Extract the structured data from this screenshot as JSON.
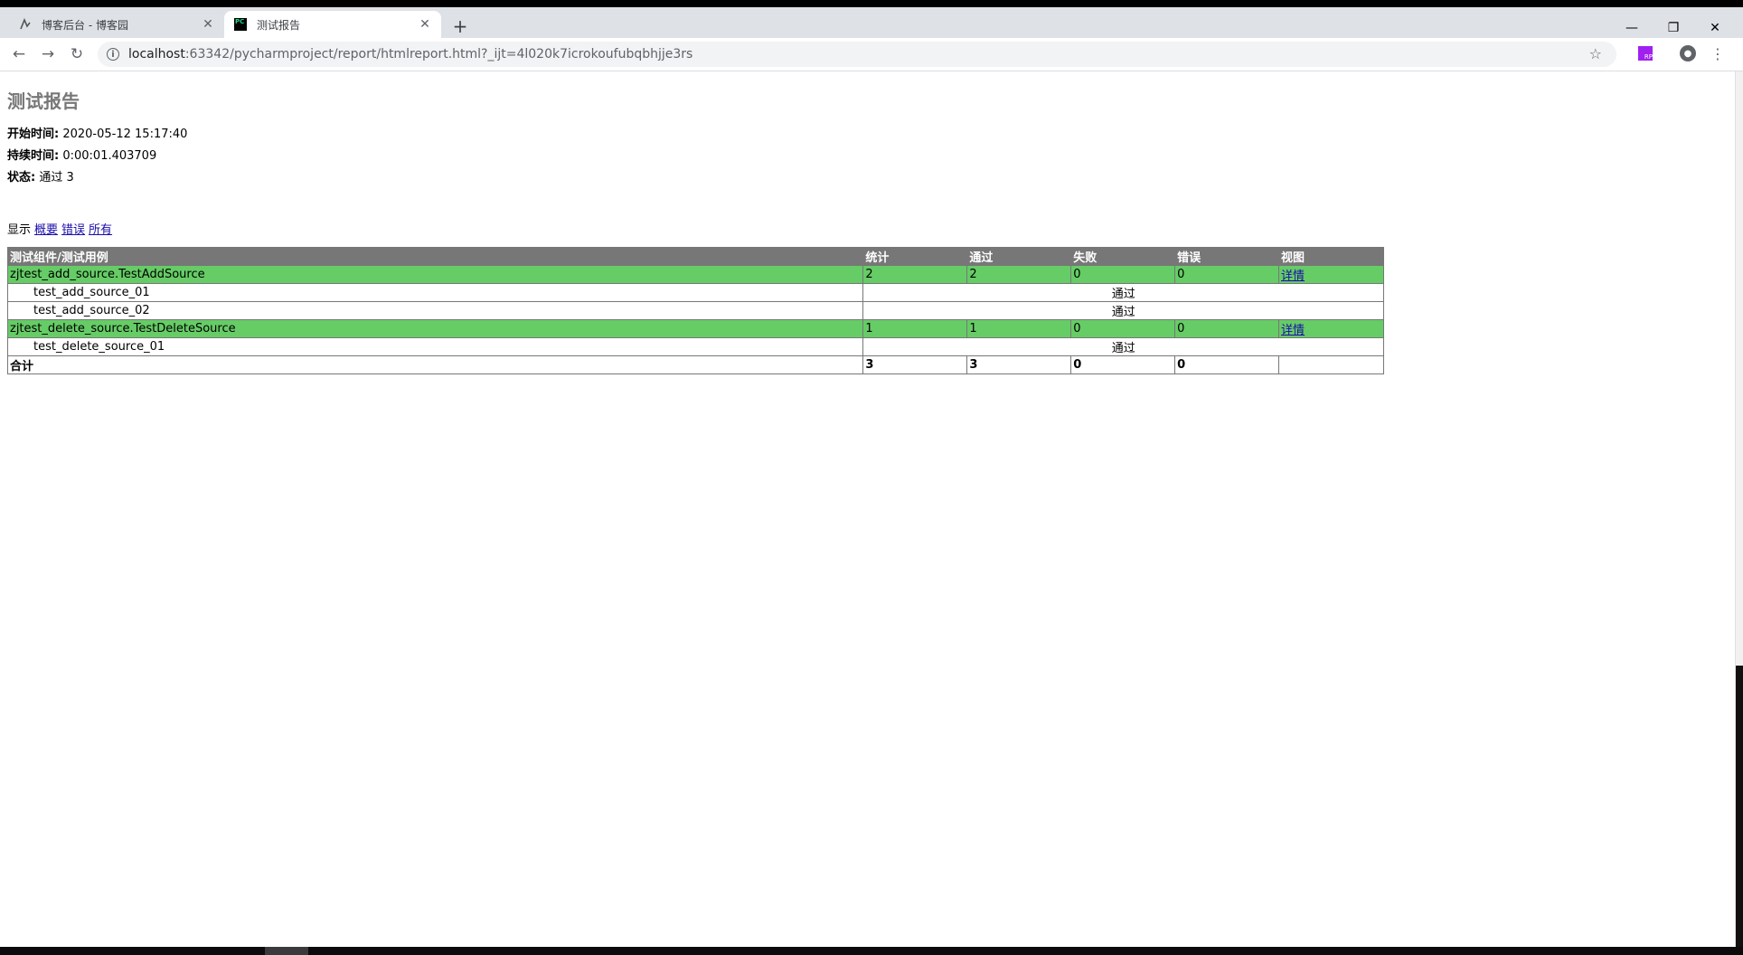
{
  "browser": {
    "tabs": [
      {
        "title": "博客后台 - 博客园",
        "active": false,
        "icon": "cnblogs-icon"
      },
      {
        "title": "测试报告",
        "active": true,
        "icon": "pycharm-icon",
        "icon_text": "PC"
      }
    ],
    "url_host": "localhost",
    "url_rest": ":63342/pycharmproject/report/htmlreport.html?_ijt=4l020k7icrokoufubqbhjje3rs",
    "ext_label": "RP"
  },
  "report": {
    "title": "测试报告",
    "start_label": "开始时间:",
    "start_value": "2020-05-12 15:17:40",
    "duration_label": "持续时间:",
    "duration_value": "0:00:01.403709",
    "status_label": "状态:",
    "status_value": "通过 3",
    "filter_label": "显示",
    "filter_links": [
      "概要",
      "错误",
      "所有"
    ]
  },
  "table": {
    "headers": [
      "测试组件/测试用例",
      "统计",
      "通过",
      "失败",
      "错误",
      "视图"
    ],
    "suites": [
      {
        "name": "zjtest_add_source.TestAddSource",
        "count": "2",
        "pass": "2",
        "fail": "0",
        "error": "0",
        "view": "详情",
        "cases": [
          {
            "name": "test_add_source_01",
            "status": "通过"
          },
          {
            "name": "test_add_source_02",
            "status": "通过"
          }
        ]
      },
      {
        "name": "zjtest_delete_source.TestDeleteSource",
        "count": "1",
        "pass": "1",
        "fail": "0",
        "error": "0",
        "view": "详情",
        "cases": [
          {
            "name": "test_delete_source_01",
            "status": "通过"
          }
        ]
      }
    ],
    "total": {
      "label": "合计",
      "count": "3",
      "pass": "3",
      "fail": "0",
      "error": "0"
    }
  },
  "colors": {
    "pass_row": "#66cc66",
    "header_row": "#777777",
    "title": "#777777"
  }
}
